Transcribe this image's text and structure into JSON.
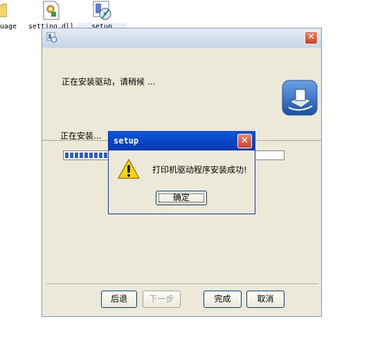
{
  "desktop": {
    "icons": [
      {
        "label": "uage",
        "icon": "folder-icon"
      },
      {
        "label": "setting.dll",
        "icon": "dll-file-icon"
      },
      {
        "label": "setup",
        "icon": "setup-program-icon"
      }
    ]
  },
  "installer": {
    "header_text": "正在安装驱动，请稍候 ...",
    "status_text": "正在安装...",
    "progress": 0.25,
    "buttons": {
      "back": "后退",
      "next": "下一步",
      "finish": "完成",
      "cancel": "取消"
    },
    "close_glyph": "✕"
  },
  "message_box": {
    "title": "setup",
    "message": "打印机驱动程序安装成功!",
    "ok_label": "确定",
    "icon": "warning-icon",
    "close_glyph": "✕"
  },
  "colors": {
    "window_bg": "#ece9d8",
    "titlebar_blue": "#0a4bc8",
    "progress_blue": "#2f5fbf"
  }
}
